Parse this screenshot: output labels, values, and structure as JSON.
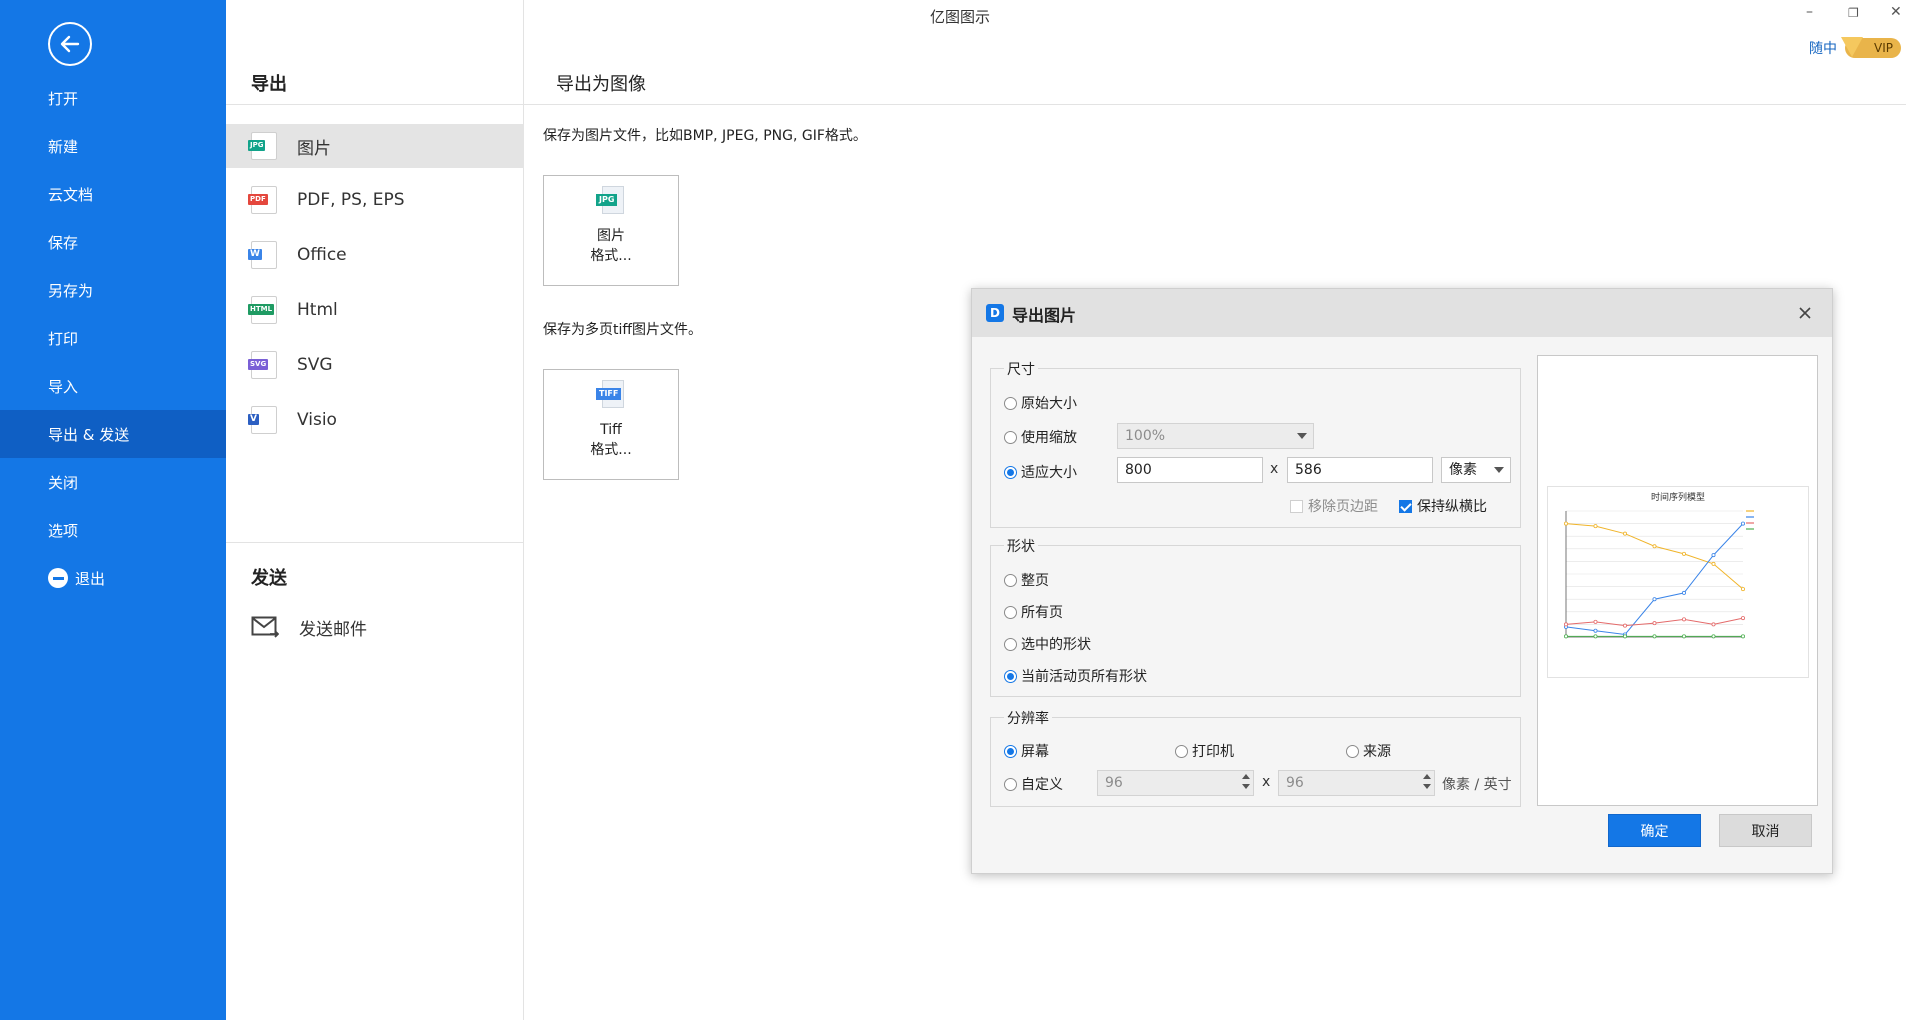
{
  "app": {
    "title": "亿图图示",
    "user": "随中",
    "vip": "VIP"
  },
  "sidebar": {
    "items": [
      {
        "id": "open",
        "label": "打开"
      },
      {
        "id": "new",
        "label": "新建"
      },
      {
        "id": "cloud",
        "label": "云文档"
      },
      {
        "id": "save",
        "label": "保存"
      },
      {
        "id": "saveas",
        "label": "另存为"
      },
      {
        "id": "print",
        "label": "打印"
      },
      {
        "id": "import",
        "label": "导入"
      },
      {
        "id": "export",
        "label": "导出 & 发送"
      },
      {
        "id": "close",
        "label": "关闭"
      },
      {
        "id": "options",
        "label": "选项"
      },
      {
        "id": "exit",
        "label": "退出"
      }
    ],
    "active": "export"
  },
  "export_panel": {
    "heading": "导出",
    "formats": [
      {
        "label": "图片",
        "tag": "JPG",
        "color": "#12a38a"
      },
      {
        "label": "PDF, PS, EPS",
        "tag": "PDF",
        "color": "#e4473d"
      },
      {
        "label": "Office",
        "tag": "W",
        "color": "#3a84e8"
      },
      {
        "label": "Html",
        "tag": "HTML",
        "color": "#1f9b63"
      },
      {
        "label": "SVG",
        "tag": "SVG",
        "color": "#7a5fd6"
      },
      {
        "label": "Visio",
        "tag": "V",
        "color": "#2c5fc2"
      }
    ],
    "send_heading": "发送",
    "send_email": "发送邮件"
  },
  "main": {
    "title": "导出为图像",
    "desc1": "保存为图片文件，比如BMP, JPEG, PNG, GIF格式。",
    "card1": {
      "tag": "JPG",
      "line1": "图片",
      "line2": "格式..."
    },
    "desc2": "保存为多页tiff图片文件。",
    "card2": {
      "tag": "TIFF",
      "line1": "Tiff",
      "line2": "格式..."
    }
  },
  "dialog": {
    "title": "导出图片",
    "size_group": "尺寸",
    "original_size": "原始大小",
    "use_zoom": "使用缩放",
    "zoom_value": "100%",
    "fit_size": "适应大小",
    "width": "800",
    "times": "x",
    "height": "586",
    "unit": "像素",
    "remove_margin": "移除页边距",
    "keep_ratio": "保持纵横比",
    "shape_group": "形状",
    "whole_page": "整页",
    "all_pages": "所有页",
    "selected_shapes": "选中的形状",
    "active_page_shapes": "当前活动页所有形状",
    "resolution_group": "分辨率",
    "screen": "屏幕",
    "printer": "打印机",
    "source": "来源",
    "custom": "自定义",
    "dpi_x": "96",
    "dpi_y": "96",
    "dpi_unit": "像素 / 英寸",
    "ok": "确定",
    "cancel": "取消",
    "preview_title": "时间序列模型"
  },
  "chart_data": {
    "type": "line",
    "title": "时间序列模型",
    "x": [
      1,
      2,
      3,
      4,
      5,
      6,
      7
    ],
    "series": [
      {
        "color": "#f0b429",
        "values": [
          900,
          880,
          820,
          720,
          660,
          580,
          380
        ]
      },
      {
        "color": "#3a84e8",
        "values": [
          80,
          50,
          20,
          300,
          350,
          650,
          900
        ]
      },
      {
        "color": "#e46a6a",
        "values": [
          100,
          120,
          90,
          110,
          140,
          100,
          150
        ]
      },
      {
        "color": "#4caf50",
        "values": [
          5,
          5,
          5,
          5,
          5,
          5,
          5
        ]
      }
    ],
    "ylim": [
      0,
      1000
    ],
    "grid": true,
    "legend": "top-right"
  }
}
